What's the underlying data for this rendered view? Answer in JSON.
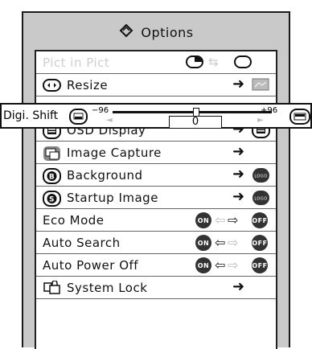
{
  "title": "Options",
  "items": [
    {
      "label": "Pict in Pict",
      "disabled": true,
      "icon": "",
      "right": ""
    },
    {
      "label": "Resize",
      "icon": "resize-icon",
      "right": "resize-preview-icon"
    },
    {
      "label": "OSD Display",
      "icon": "osd-icon",
      "right": "osd-preview-icon"
    },
    {
      "label": "Image Capture",
      "icon": "capture-icon",
      "right": ""
    },
    {
      "label": "Background",
      "icon": "b-icon",
      "right": "logo-icon"
    },
    {
      "label": "Startup Image",
      "icon": "s-icon",
      "right": "logo-icon"
    },
    {
      "label": "Eco Mode",
      "icon": "",
      "right": "on-off"
    },
    {
      "label": "Auto Search",
      "icon": "",
      "right": "on-off"
    },
    {
      "label": "Auto Power Off",
      "icon": "",
      "right": "on-off"
    },
    {
      "label": "System Lock",
      "icon": "lock-icon",
      "right": ""
    }
  ],
  "digi_shift": {
    "label": "Digi. Shift",
    "min": "−96",
    "max": "+96",
    "value": "0"
  },
  "toggle": {
    "on": "ON",
    "off": "OFF"
  },
  "logo_text": "LOGO"
}
